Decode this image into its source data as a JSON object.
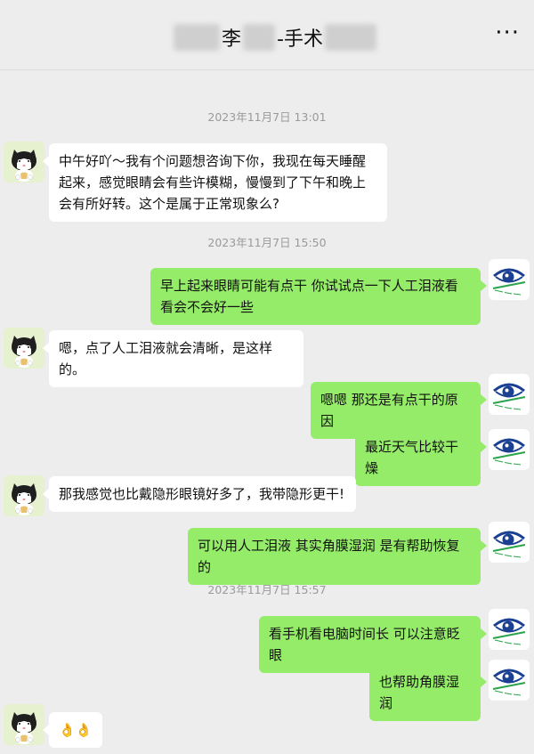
{
  "header": {
    "title_name_char": "李",
    "title_suffix": "-手术",
    "more_label": "···"
  },
  "timestamps": [
    "2023年11月7日 13:01",
    "2023年11月7日 15:50",
    "2023年11月7日 15:57"
  ],
  "messages": [
    {
      "sender": "patient",
      "text": "中午好吖～我有个问题想咨询下你，我现在每天睡醒起来，感觉眼睛会有些许模糊，慢慢到了下午和晚上会有所好转。这个是属于正常现象么?"
    },
    {
      "sender": "doctor",
      "text": "早上起来眼睛可能有点干 你试试点一下人工泪液看看会不会好一些"
    },
    {
      "sender": "patient",
      "text": "嗯，点了人工泪液就会清晰，是这样的。"
    },
    {
      "sender": "doctor",
      "text": "嗯嗯 那还是有点干的原因"
    },
    {
      "sender": "doctor",
      "text": "最近天气比较干燥"
    },
    {
      "sender": "patient",
      "text": "那我感觉也比戴隐形眼镜好多了，我带隐形更干!"
    },
    {
      "sender": "doctor",
      "text": "可以用人工泪液 其实角膜湿润 是有帮助恢复的"
    },
    {
      "sender": "doctor",
      "text": "看手机看电脑时间长 可以注意眨眼"
    },
    {
      "sender": "doctor",
      "text": "也帮助角膜湿润"
    },
    {
      "sender": "patient",
      "text": "👌👌"
    }
  ],
  "colors": {
    "background": "#ededed",
    "bubble_self": "#95ec69",
    "bubble_other": "#ffffff",
    "logo_blue": "#1a3f93",
    "logo_green": "#2aa34a"
  },
  "icons": {
    "patient_avatar": "cat-avatar-icon",
    "doctor_avatar": "eye-hospital-logo-icon"
  }
}
